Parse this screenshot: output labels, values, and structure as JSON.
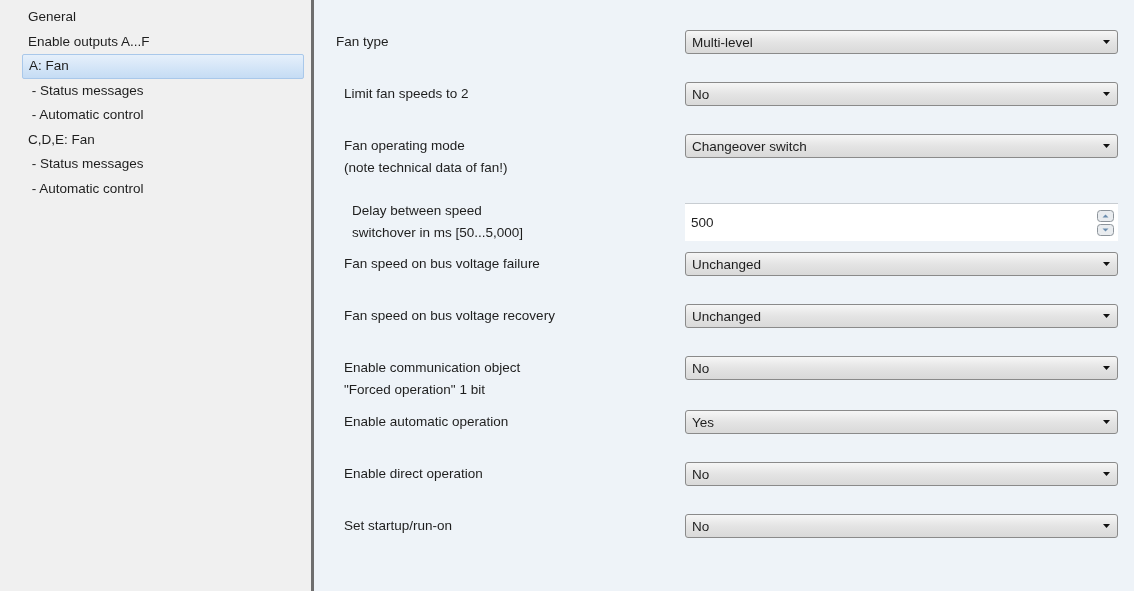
{
  "sidebar": {
    "items": [
      {
        "label": "General",
        "selected": false
      },
      {
        "label": "Enable outputs A...F",
        "selected": false
      },
      {
        "label": "A: Fan",
        "selected": true
      },
      {
        "label": " - Status messages",
        "selected": false
      },
      {
        "label": " - Automatic control",
        "selected": false
      },
      {
        "label": "C,D,E: Fan",
        "selected": false
      },
      {
        "label": " - Status messages",
        "selected": false
      },
      {
        "label": " - Automatic control",
        "selected": false
      }
    ]
  },
  "parameters": [
    {
      "label": "Fan type",
      "kind": "dropdown",
      "value": "Multi-level",
      "children": [
        {
          "label": "Limit fan speeds to 2",
          "kind": "dropdown",
          "value": "No"
        },
        {
          "label": "Fan operating mode\n(note technical data of fan!)",
          "kind": "dropdown",
          "value": "Changeover switch",
          "children": [
            {
              "label": "Delay between speed\nswitchover in ms [50...5,000]",
              "kind": "spinner",
              "value": "500"
            }
          ]
        },
        {
          "label": "Fan speed on bus voltage failure",
          "kind": "dropdown",
          "value": "Unchanged"
        },
        {
          "label": "Fan speed on bus voltage recovery",
          "kind": "dropdown",
          "value": "Unchanged"
        },
        {
          "label": "Enable communication object\n\"Forced operation\" 1 bit",
          "kind": "dropdown",
          "value": "No"
        },
        {
          "label": "Enable automatic operation",
          "kind": "dropdown",
          "value": "Yes"
        },
        {
          "label": "Enable direct operation",
          "kind": "dropdown",
          "value": "No"
        },
        {
          "label": "Set startup/run-on",
          "kind": "dropdown",
          "value": "No"
        }
      ]
    }
  ]
}
